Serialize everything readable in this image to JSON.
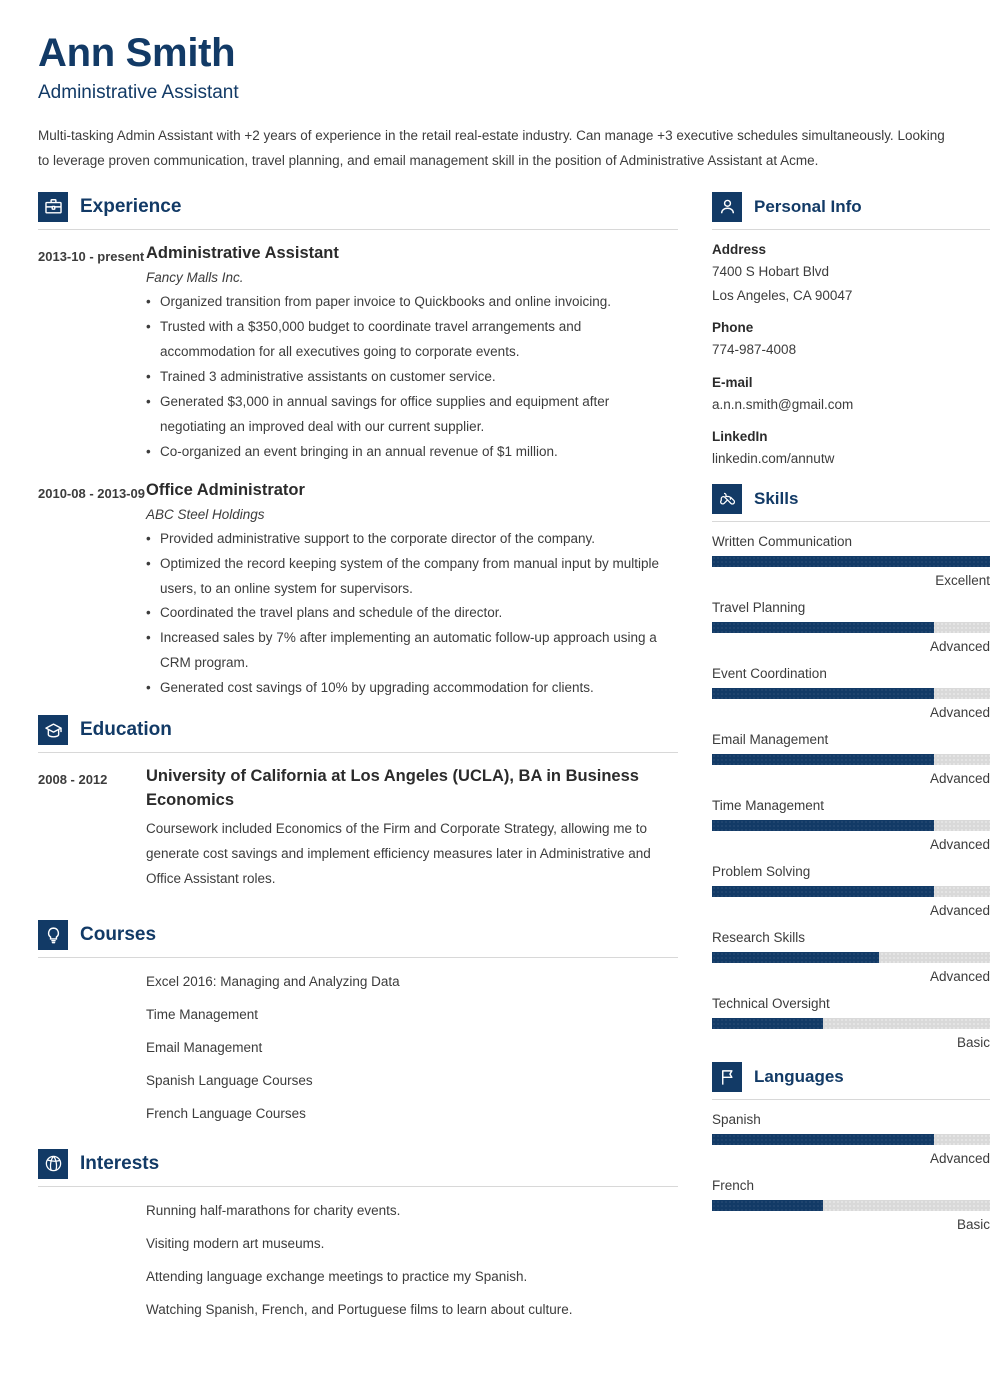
{
  "theme": {
    "accent": "#123a66",
    "text": "#3c3c3c",
    "bar_track": "#d9d9d9"
  },
  "header": {
    "name": "Ann Smith",
    "job_title": "Administrative Assistant",
    "summary": "Multi-tasking Admin Assistant with +2 years of experience in the retail real-estate industry. Can manage +3 executive schedules simultaneously. Looking to leverage proven communication, travel planning, and email management skill in the position of Administrative Assistant at Acme."
  },
  "experience": {
    "title": "Experience",
    "icon": "briefcase-icon",
    "entries": [
      {
        "date": "2013-10 - present",
        "title": "Administrative Assistant",
        "company": "Fancy Malls Inc.",
        "bullets": [
          "Organized transition from paper invoice to Quickbooks and online invoicing.",
          "Trusted with a $350,000 budget to coordinate travel arrangements and accommodation for all executives going to corporate events.",
          "Trained 3 administrative assistants on customer service.",
          "Generated $3,000 in annual savings for office supplies and equipment after negotiating an improved deal with our current supplier.",
          "Co-organized an event bringing in an annual revenue of $1 million."
        ]
      },
      {
        "date": "2010-08 - 2013-09",
        "title": "Office Administrator",
        "company": "ABC Steel Holdings",
        "bullets": [
          "Provided administrative support to the corporate director of the company.",
          "Optimized the record keeping system of the company from manual input by multiple users, to an online system for supervisors.",
          "Coordinated the travel plans and schedule of the director.",
          "Increased sales by 7% after implementing an automatic follow-up approach using a CRM program.",
          "Generated cost savings of 10% by upgrading accommodation for clients."
        ]
      }
    ]
  },
  "education": {
    "title": "Education",
    "icon": "graduation-cap-icon",
    "entries": [
      {
        "date": "2008 - 2012",
        "title": "University of California at Los Angeles (UCLA), BA in Business Economics",
        "description": "Coursework included Economics of the Firm and Corporate Strategy, allowing me to generate cost savings and implement efficiency measures later in Administrative and Office Assistant roles."
      }
    ]
  },
  "courses": {
    "title": "Courses",
    "icon": "lightbulb-icon",
    "items": [
      "Excel 2016: Managing and Analyzing Data",
      "Time Management",
      "Email Management",
      "Spanish Language Courses",
      "French Language Courses"
    ]
  },
  "interests": {
    "title": "Interests",
    "icon": "ball-icon",
    "items": [
      "Running half-marathons for charity events.",
      "Visiting modern art museums.",
      "Attending language exchange meetings to practice my Spanish.",
      "Watching Spanish, French, and Portuguese films to learn about culture."
    ]
  },
  "personal_info": {
    "title": "Personal Info",
    "icon": "person-icon",
    "blocks": [
      {
        "label": "Address",
        "line1": "7400 S Hobart Blvd",
        "line2": "Los Angeles, CA 90047"
      },
      {
        "label": "Phone",
        "line1": "774-987-4008",
        "line2": ""
      },
      {
        "label": "E-mail",
        "line1": "a.n.n.smith@gmail.com",
        "line2": ""
      },
      {
        "label": "LinkedIn",
        "line1": "linkedin.com/annutw",
        "line2": ""
      }
    ]
  },
  "skills": {
    "title": "Skills",
    "icon": "puzzle-icon",
    "items": [
      {
        "name": "Written Communication",
        "level": "Excellent",
        "percent": 100
      },
      {
        "name": "Travel Planning",
        "level": "Advanced",
        "percent": 80
      },
      {
        "name": "Event Coordination",
        "level": "Advanced",
        "percent": 80
      },
      {
        "name": "Email Management",
        "level": "Advanced",
        "percent": 80
      },
      {
        "name": "Time Management",
        "level": "Advanced",
        "percent": 80
      },
      {
        "name": "Problem Solving",
        "level": "Advanced",
        "percent": 80
      },
      {
        "name": "Research Skills",
        "level": "Advanced",
        "percent": 60
      },
      {
        "name": "Technical Oversight",
        "level": "Basic",
        "percent": 40
      }
    ]
  },
  "languages": {
    "title": "Languages",
    "icon": "flag-icon",
    "items": [
      {
        "name": "Spanish",
        "level": "Advanced",
        "percent": 80
      },
      {
        "name": "French",
        "level": "Basic",
        "percent": 40
      }
    ]
  }
}
